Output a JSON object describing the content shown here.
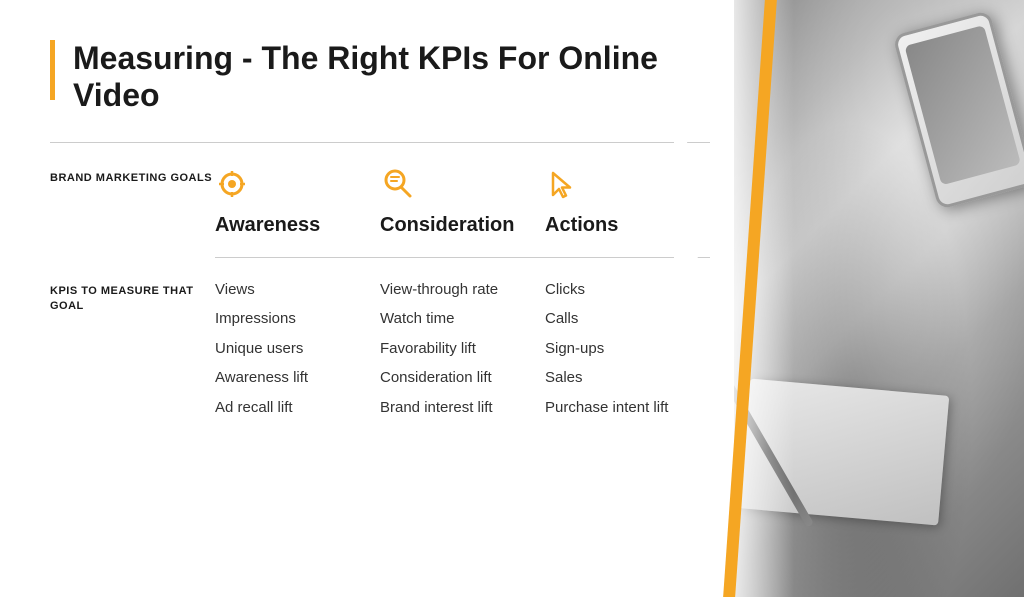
{
  "title": "Measuring - The Right KPIs For Online Video",
  "section_goals_label": "BRAND MARKETING GOALS",
  "section_kpis_label": "KPIs TO MEASURE THAT GOAL",
  "goals": [
    {
      "id": "awareness",
      "icon": "👁",
      "label": "Awareness",
      "kpis": [
        "Views",
        "Impressions",
        "Unique users",
        "Awareness lift",
        "Ad recall lift"
      ]
    },
    {
      "id": "consideration",
      "icon": "🔍",
      "label": "Consideration",
      "kpis": [
        "View-through rate",
        "Watch time",
        "Favorability lift",
        "Consideration lift",
        "Brand interest lift"
      ]
    },
    {
      "id": "actions",
      "icon": "🖱",
      "label": "Actions",
      "kpis": [
        "Clicks",
        "Calls",
        "Sign-ups",
        "Sales",
        "Purchase intent lift"
      ]
    }
  ],
  "accent_color": "#f5a623",
  "text_color": "#1a1a1a"
}
